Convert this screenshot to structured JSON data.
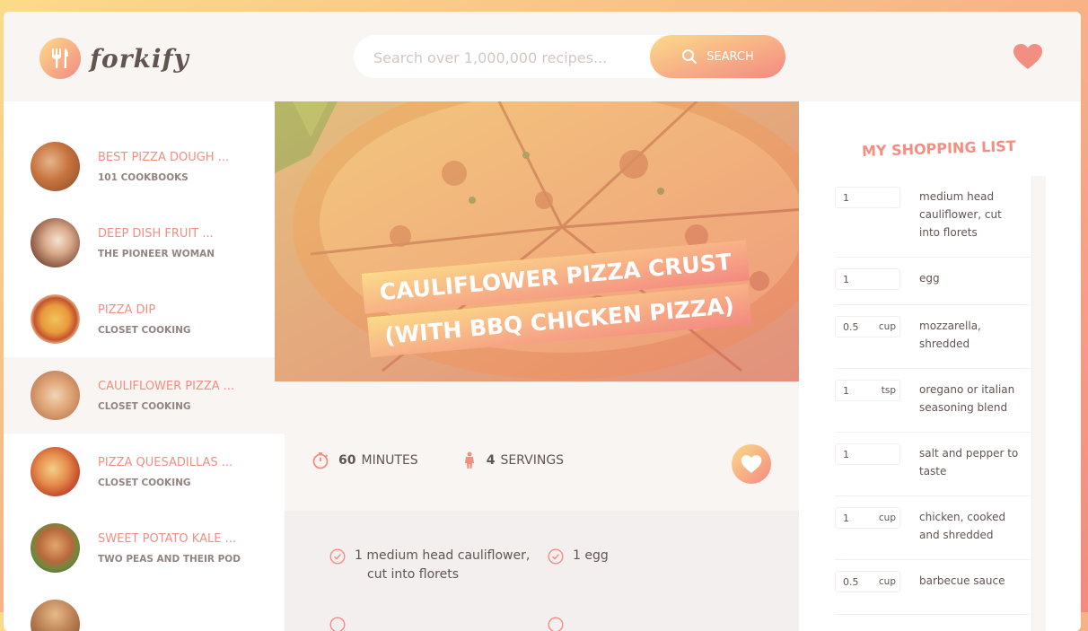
{
  "header": {
    "logo_text": "forkify",
    "search_placeholder": "Search over 1,000,000 recipes...",
    "search_button": "Search"
  },
  "results": [
    {
      "title": "Best Pizza Dough ...",
      "publisher": "101 Cookbooks",
      "active": false
    },
    {
      "title": "Deep Dish Fruit ...",
      "publisher": "The Pioneer Woman",
      "active": false
    },
    {
      "title": "Pizza Dip",
      "publisher": "Closet Cooking",
      "active": false
    },
    {
      "title": "Cauliflower Pizza ...",
      "publisher": "Closet Cooking",
      "active": true
    },
    {
      "title": "Pizza Quesadillas ...",
      "publisher": "Closet Cooking",
      "active": false
    },
    {
      "title": "Sweet Potato Kale ...",
      "publisher": "Two Peas and Their Pod",
      "active": false
    }
  ],
  "recipe": {
    "title": "Cauliflower Pizza Crust (with BBQ Chicken Pizza)",
    "minutes": "60",
    "minutes_label": "minutes",
    "servings": "4",
    "servings_label": "servings",
    "ingredients": [
      {
        "text": "1 medium head cauliflower,",
        "text2": "cut into florets"
      },
      {
        "text": "1 egg",
        "text2": ""
      }
    ]
  },
  "shopping": {
    "heading": "My Shopping List",
    "items": [
      {
        "count": "1",
        "unit": "",
        "desc": "medium head cauliflower, cut into florets"
      },
      {
        "count": "1",
        "unit": "",
        "desc": "egg"
      },
      {
        "count": "0.5",
        "unit": "cup",
        "desc": "mozzarella, shredded"
      },
      {
        "count": "1",
        "unit": "tsp",
        "desc": "oregano or italian seasoning blend"
      },
      {
        "count": "1",
        "unit": "",
        "desc": "salt and pepper to taste"
      },
      {
        "count": "1",
        "unit": "cup",
        "desc": "chicken, cooked and shredded"
      },
      {
        "count": "0.5",
        "unit": "cup",
        "desc": "barbecue sauce"
      }
    ]
  },
  "colors": {
    "accent": "#f38e82",
    "gradient_start": "#fbdb89",
    "gradient_end": "#f48982"
  }
}
